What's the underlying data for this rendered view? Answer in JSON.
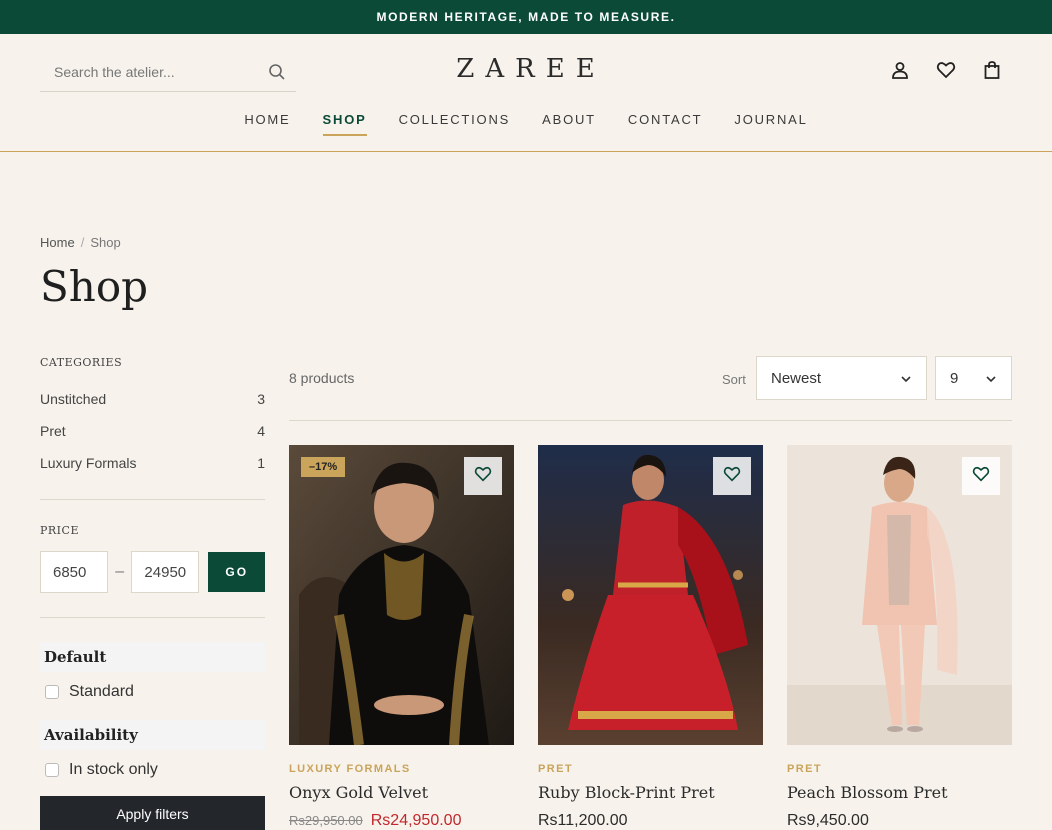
{
  "announcement": "MODERN HERITAGE, MADE TO MEASURE.",
  "search": {
    "placeholder": "Search the atelier..."
  },
  "brand": "ZAREE",
  "nav": [
    {
      "label": "HOME"
    },
    {
      "label": "SHOP"
    },
    {
      "label": "COLLECTIONS"
    },
    {
      "label": "ABOUT"
    },
    {
      "label": "CONTACT"
    },
    {
      "label": "JOURNAL"
    }
  ],
  "breadcrumb": {
    "home": "Home",
    "separator": "/",
    "current": "Shop"
  },
  "page_title": "Shop",
  "sidebar": {
    "categories_heading": "CATEGORIES",
    "categories": [
      {
        "label": "Unstitched",
        "count": "3"
      },
      {
        "label": "Pret",
        "count": "4"
      },
      {
        "label": "Luxury Formals",
        "count": "1"
      }
    ],
    "price_heading": "PRICE",
    "price_min": "6850",
    "price_max": "24950",
    "price_dash": "–",
    "go_label": "GO",
    "default_title": "Default",
    "default_option": "Standard",
    "availability_title": "Availability",
    "availability_option": "In stock only",
    "apply_label": "Apply filters"
  },
  "toolbar": {
    "count": "8 products",
    "sort_label": "Sort",
    "sort_value": "Newest",
    "per_page_value": "9"
  },
  "products": [
    {
      "category": "LUXURY FORMALS",
      "name": "Onyx Gold Velvet",
      "old_price": "Rs29,950.00",
      "price": "Rs24,950.00",
      "badge": "–17%"
    },
    {
      "category": "PRET",
      "name": "Ruby Block-Print Pret",
      "price": "Rs11,200.00"
    },
    {
      "category": "PRET",
      "name": "Peach Blossom Pret",
      "price": "Rs9,450.00"
    }
  ],
  "colors": {
    "brand_green": "#0b4a37",
    "gold": "#c9a45a",
    "sale_red": "#c0282d"
  }
}
